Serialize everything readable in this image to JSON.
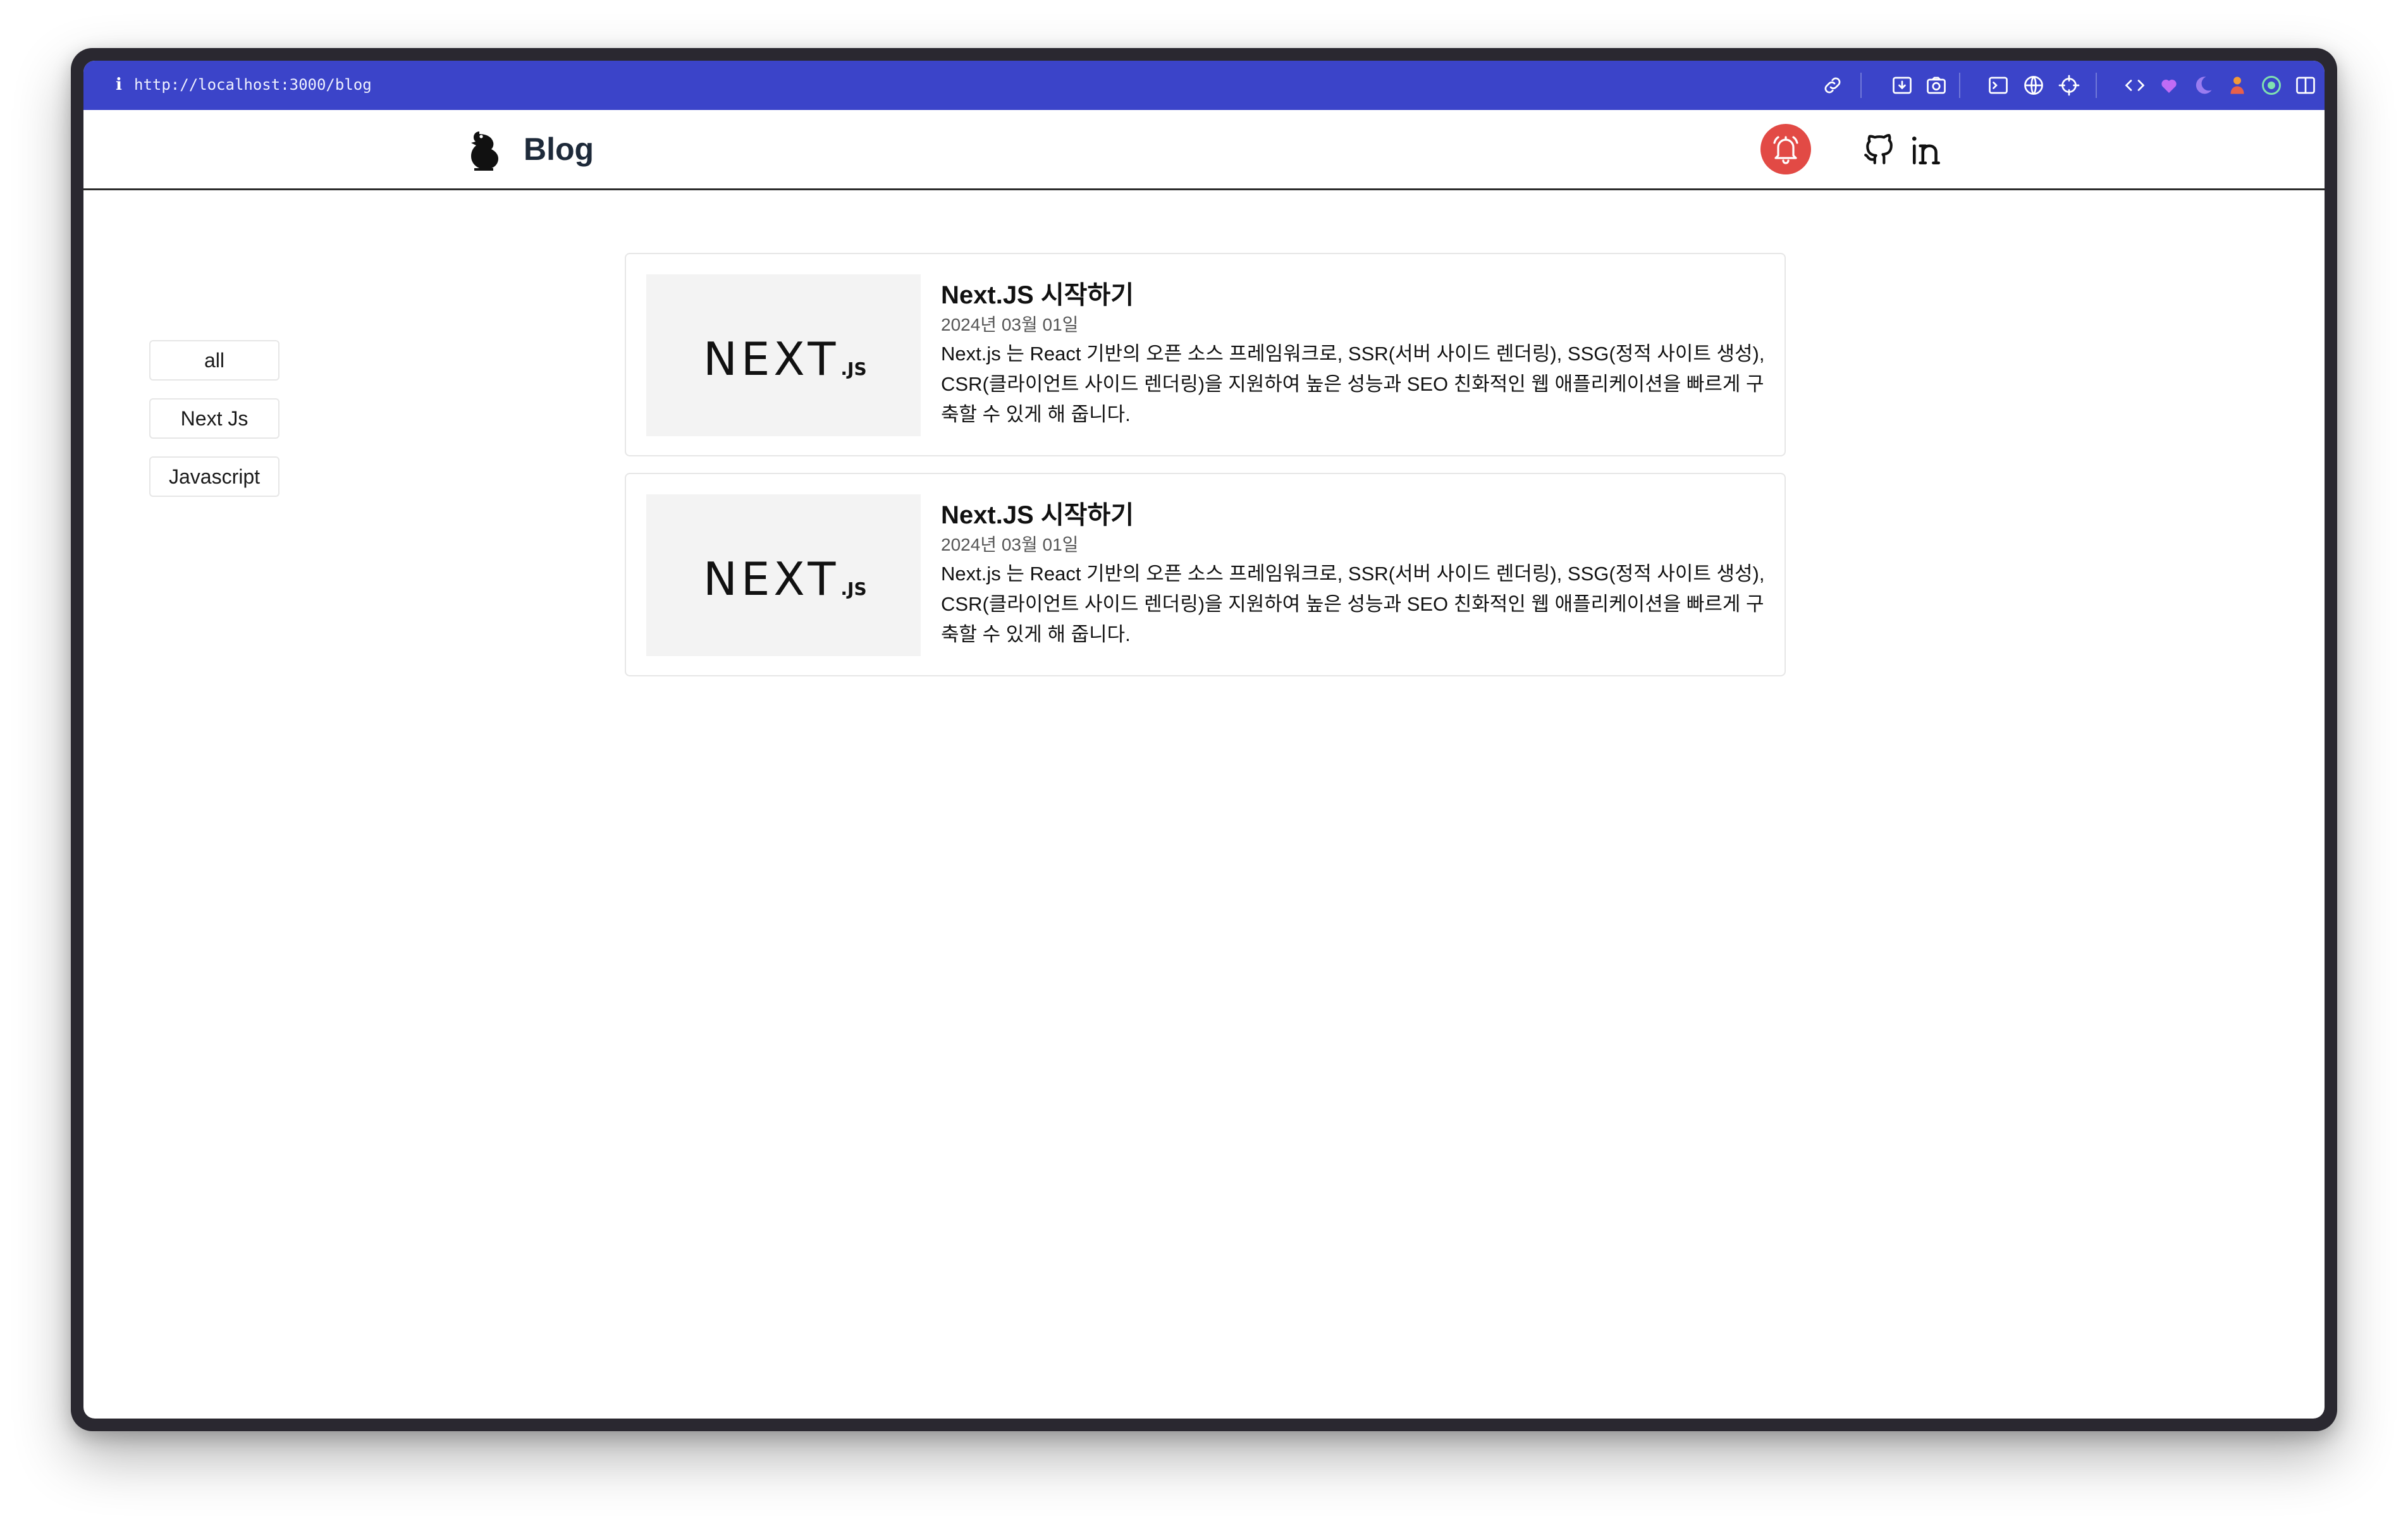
{
  "browser": {
    "url": "http://localhost:3000/blog",
    "info_glyph": "i",
    "icons": [
      "link-icon",
      "download-icon",
      "camera-icon",
      "terminal-icon",
      "globe-icon",
      "crosshair-icon",
      "code-icon",
      "heart-extension-icon",
      "moon-extension-icon",
      "person-extension-icon",
      "target-extension-icon",
      "sidebar-toggle-icon"
    ],
    "accent": "#3b44c9"
  },
  "header": {
    "title": "Blog",
    "bell_color": "#e24a45"
  },
  "sidebar": {
    "categories": [
      "all",
      "Next Js",
      "Javascript"
    ]
  },
  "posts": [
    {
      "thumbnail": "NEXT",
      "thumbnail_suffix": ".JS",
      "title": "Next.JS 시작하기",
      "date": "2024년 03월 01일",
      "description": "Next.js 는 React 기반의 오픈 소스 프레임워크로, SSR(서버 사이드 렌더링), SSG(정적 사이트 생성), CSR(클라이언트 사이드 렌더링)을 지원하여 높은 성능과 SEO 친화적인 웹 애플리케이션을 빠르게 구축할 수 있게 해 줍니다."
    },
    {
      "thumbnail": "NEXT",
      "thumbnail_suffix": ".JS",
      "title": "Next.JS 시작하기",
      "date": "2024년 03월 01일",
      "description": "Next.js 는 React 기반의 오픈 소스 프레임워크로, SSR(서버 사이드 렌더링), SSG(정적 사이트 생성), CSR(클라이언트 사이드 렌더링)을 지원하여 높은 성능과 SEO 친화적인 웹 애플리케이션을 빠르게 구축할 수 있게 해 줍니다."
    }
  ]
}
